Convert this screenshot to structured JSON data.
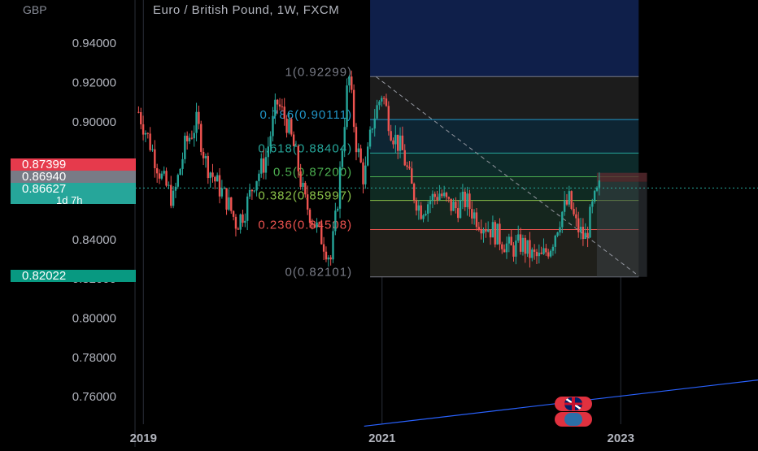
{
  "title": "Euro / British Pound, 1W, FXCM",
  "currency": "GBP",
  "colors": {
    "background": "#000000",
    "up": "#26a69a",
    "down": "#ef5350",
    "fib_zone_top": "#1b3a7a",
    "trendline": "#2962ff"
  },
  "price_tags": {
    "tag1": "0.87399",
    "tag2": "0.86940",
    "tag3_price": "0.86627",
    "tag3_countdown": "1d 7h",
    "tag4": "0.82022"
  },
  "fib_labels": [
    {
      "text": "1(0.92299)",
      "price": 0.92299
    },
    {
      "text": "0.786(0.90111)",
      "price": 0.90111
    },
    {
      "text": "0.618(0.88404)",
      "price": 0.88404
    },
    {
      "text": "0.5(0.87200)",
      "price": 0.872
    },
    {
      "text": "0.382(0.85997)",
      "price": 0.85997
    },
    {
      "text": "0.236(0.84508)",
      "price": 0.84508
    },
    {
      "text": "0(0.82101)",
      "price": 0.82101
    }
  ],
  "flags": {
    "uk": "uk-flag-icon",
    "eu": "eu-flag-icon"
  },
  "chart_data": {
    "type": "candlestick",
    "title": "Euro / British Pound, 1W, FXCM",
    "y_ticks": [
      "0.94000",
      "0.92000",
      "0.90000",
      "0.84000",
      "0.82000",
      "0.80000",
      "0.78000",
      "0.76000"
    ],
    "y_tick_values": [
      0.94,
      0.92,
      0.9,
      0.84,
      0.82,
      0.8,
      0.78,
      0.76
    ],
    "ylim": [
      0.746,
      0.962
    ],
    "x_ticks": [
      "2019",
      "2021",
      "2023"
    ],
    "x_tick_years": [
      2019,
      2021,
      2023
    ],
    "xlim": [
      2018.93,
      2024.15
    ],
    "grid": true,
    "price_path": [
      [
        2018.96,
        0.905
      ],
      [
        2019.05,
        0.89
      ],
      [
        2019.15,
        0.872
      ],
      [
        2019.25,
        0.86
      ],
      [
        2019.35,
        0.888
      ],
      [
        2019.45,
        0.9
      ],
      [
        2019.52,
        0.88
      ],
      [
        2019.6,
        0.87
      ],
      [
        2019.7,
        0.86
      ],
      [
        2019.78,
        0.848
      ],
      [
        2019.85,
        0.855
      ],
      [
        2019.93,
        0.87
      ],
      [
        2020.02,
        0.88
      ],
      [
        2020.12,
        0.91
      ],
      [
        2020.2,
        0.9
      ],
      [
        2020.27,
        0.885
      ],
      [
        2020.35,
        0.86
      ],
      [
        2020.42,
        0.85
      ],
      [
        2020.5,
        0.84
      ],
      [
        2020.57,
        0.83
      ],
      [
        2020.62,
        0.855
      ],
      [
        2020.67,
        0.89
      ],
      [
        2020.72,
        0.925
      ],
      [
        2020.78,
        0.89
      ],
      [
        2020.85,
        0.87
      ],
      [
        2020.92,
        0.9
      ],
      [
        2021.0,
        0.915
      ],
      [
        2021.08,
        0.895
      ],
      [
        2021.17,
        0.885
      ],
      [
        2021.25,
        0.866
      ],
      [
        2021.32,
        0.855
      ],
      [
        2021.4,
        0.86
      ],
      [
        2021.48,
        0.864
      ],
      [
        2021.55,
        0.858
      ],
      [
        2021.62,
        0.856
      ],
      [
        2021.7,
        0.86
      ],
      [
        2021.78,
        0.852
      ],
      [
        2021.85,
        0.848
      ],
      [
        2021.92,
        0.845
      ],
      [
        2022.0,
        0.84
      ],
      [
        2022.08,
        0.835
      ],
      [
        2022.17,
        0.838
      ],
      [
        2022.25,
        0.832
      ],
      [
        2022.33,
        0.83
      ],
      [
        2022.42,
        0.838
      ],
      [
        2022.5,
        0.853
      ],
      [
        2022.57,
        0.86
      ],
      [
        2022.62,
        0.848
      ],
      [
        2022.7,
        0.84
      ],
      [
        2022.77,
        0.858
      ],
      [
        2022.82,
        0.866
      ]
    ],
    "annotations": {
      "fib_retracement": {
        "high": 0.92299,
        "low": 0.82101
      },
      "projection_box": {
        "top": 0.87399,
        "mid": 0.8694,
        "bottom": 0.82101
      },
      "current_price": 0.86627
    }
  }
}
